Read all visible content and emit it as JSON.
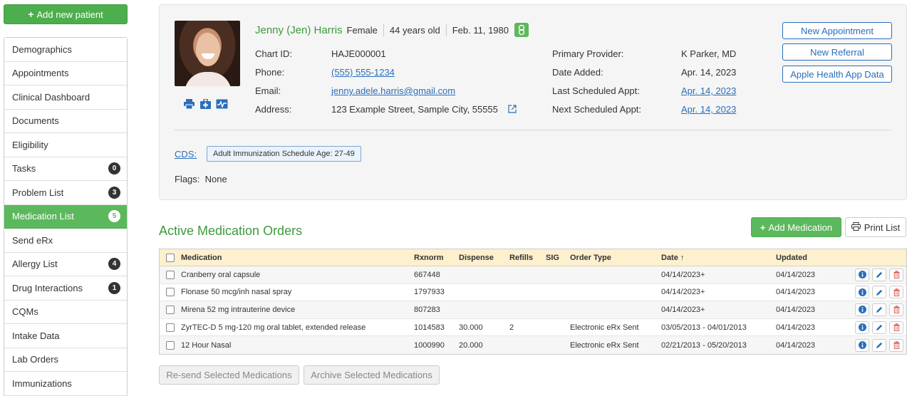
{
  "sidebar": {
    "add_patient_label": "Add new patient",
    "items": [
      {
        "label": "Demographics",
        "badge": null
      },
      {
        "label": "Appointments",
        "badge": null
      },
      {
        "label": "Clinical Dashboard",
        "badge": null
      },
      {
        "label": "Documents",
        "badge": null
      },
      {
        "label": "Eligibility",
        "badge": null
      },
      {
        "label": "Tasks",
        "badge": "0"
      },
      {
        "label": "Problem List",
        "badge": "3"
      },
      {
        "label": "Medication List",
        "badge": "5",
        "active": true
      },
      {
        "label": "Send eRx",
        "badge": null
      },
      {
        "label": "Allergy List",
        "badge": "4"
      },
      {
        "label": "Drug Interactions",
        "badge": "1"
      },
      {
        "label": "CQMs",
        "badge": null
      },
      {
        "label": "Intake Data",
        "badge": null
      },
      {
        "label": "Lab Orders",
        "badge": null
      },
      {
        "label": "Immunizations",
        "badge": null
      }
    ]
  },
  "patient": {
    "name": "Jenny (Jen) Harris",
    "gender": "Female",
    "age": "44 years old",
    "dob": "Feb. 11, 1980",
    "chart_id_label": "Chart ID:",
    "chart_id": "HAJE000001",
    "phone_label": "Phone:",
    "phone": "(555) 555-1234",
    "email_label": "Email:",
    "email": "jenny.adele.harris@gmail.com",
    "address_label": "Address:",
    "address": "123 Example Street, Sample City, 55555",
    "primary_provider_label": "Primary Provider:",
    "primary_provider": "K Parker, MD",
    "date_added_label": "Date Added:",
    "date_added": "Apr. 14, 2023",
    "last_appt_label": "Last Scheduled Appt:",
    "last_appt": "Apr. 14, 2023",
    "next_appt_label": "Next Scheduled Appt:",
    "next_appt": "Apr. 14, 2023"
  },
  "actions": {
    "new_appointment": "New Appointment",
    "new_referral": "New Referral",
    "apple_health": "Apple Health App Data"
  },
  "cds": {
    "label": "CDS:",
    "tag": "Adult Immunization Schedule Age: 27-49"
  },
  "flags": {
    "label": "Flags:",
    "value": "None"
  },
  "medications": {
    "title": "Active Medication Orders",
    "add_label": "Add Medication",
    "print_label": "Print List",
    "columns": {
      "medication": "Medication",
      "rxnorm": "Rxnorm",
      "dispense": "Dispense",
      "refills": "Refills",
      "sig": "SIG",
      "order_type": "Order Type",
      "date": "Date ↑",
      "updated": "Updated"
    },
    "rows": [
      {
        "medication": "Cranberry oral capsule",
        "rxnorm": "667448",
        "dispense": "",
        "refills": "",
        "sig": "",
        "order_type": "",
        "date": "04/14/2023+",
        "updated": "04/14/2023"
      },
      {
        "medication": "Flonase 50 mcg/inh nasal spray",
        "rxnorm": "1797933",
        "dispense": "",
        "refills": "",
        "sig": "",
        "order_type": "",
        "date": "04/14/2023+",
        "updated": "04/14/2023"
      },
      {
        "medication": "Mirena 52 mg intrauterine device",
        "rxnorm": "807283",
        "dispense": "",
        "refills": "",
        "sig": "",
        "order_type": "",
        "date": "04/14/2023+",
        "updated": "04/14/2023"
      },
      {
        "medication": "ZyrTEC-D 5 mg-120 mg oral tablet, extended release",
        "rxnorm": "1014583",
        "dispense": "30.000",
        "refills": "2",
        "sig": "",
        "order_type": "Electronic eRx Sent",
        "date": "03/05/2013 - 04/01/2013",
        "updated": "04/14/2023"
      },
      {
        "medication": "12 Hour Nasal",
        "rxnorm": "1000990",
        "dispense": "20.000",
        "refills": "",
        "sig": "",
        "order_type": "Electronic eRx Sent",
        "date": "02/21/2013 - 05/20/2013",
        "updated": "04/14/2023"
      }
    ],
    "resend_label": "Re-send Selected Medications",
    "archive_label": "Archive Selected Medications"
  },
  "colors": {
    "primary_green": "#5cb85c",
    "link_blue": "#2a6ebb",
    "table_header": "#fcf0cf",
    "delete_red": "#d9534f"
  }
}
